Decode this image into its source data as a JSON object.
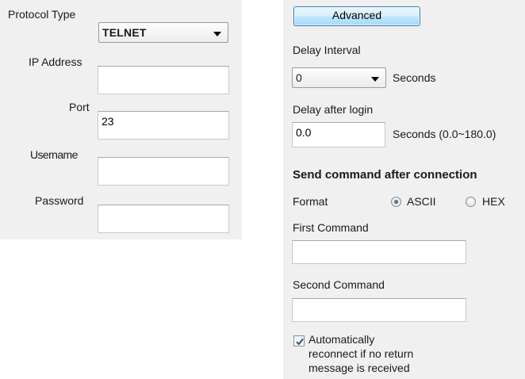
{
  "connection": {
    "protocol_type_label": "Protocol Type",
    "protocol_type_value": "TELNET",
    "ip_address_label": "IP Address",
    "ip_address_value": "",
    "port_label": "Port",
    "port_value": "23",
    "username_label": "Username",
    "username_value": "",
    "password_label": "Password",
    "password_value": ""
  },
  "advanced": {
    "button_label": "Advanced",
    "delay_interval_label": "Delay Interval",
    "delay_interval_value": "0",
    "delay_interval_unit": "Seconds",
    "delay_after_login_label": "Delay after login",
    "delay_after_login_value": "0.0",
    "delay_after_login_unit": "Seconds (0.0~180.0)",
    "send_command_heading": "Send command after connection",
    "format_label": "Format",
    "format_options": [
      "ASCII",
      "HEX"
    ],
    "format_selected": "ASCII",
    "first_command_label": "First Command",
    "first_command_value": "",
    "second_command_label": "Second Command",
    "second_command_value": "",
    "auto_reconnect_line1": "Automatically",
    "auto_reconnect_line2": "reconnect if no return",
    "auto_reconnect_line3": "message is received",
    "auto_reconnect_checked": true
  },
  "colors": {
    "panel_bg": "#f0f0f0",
    "button_border": "#3c7fb1"
  }
}
